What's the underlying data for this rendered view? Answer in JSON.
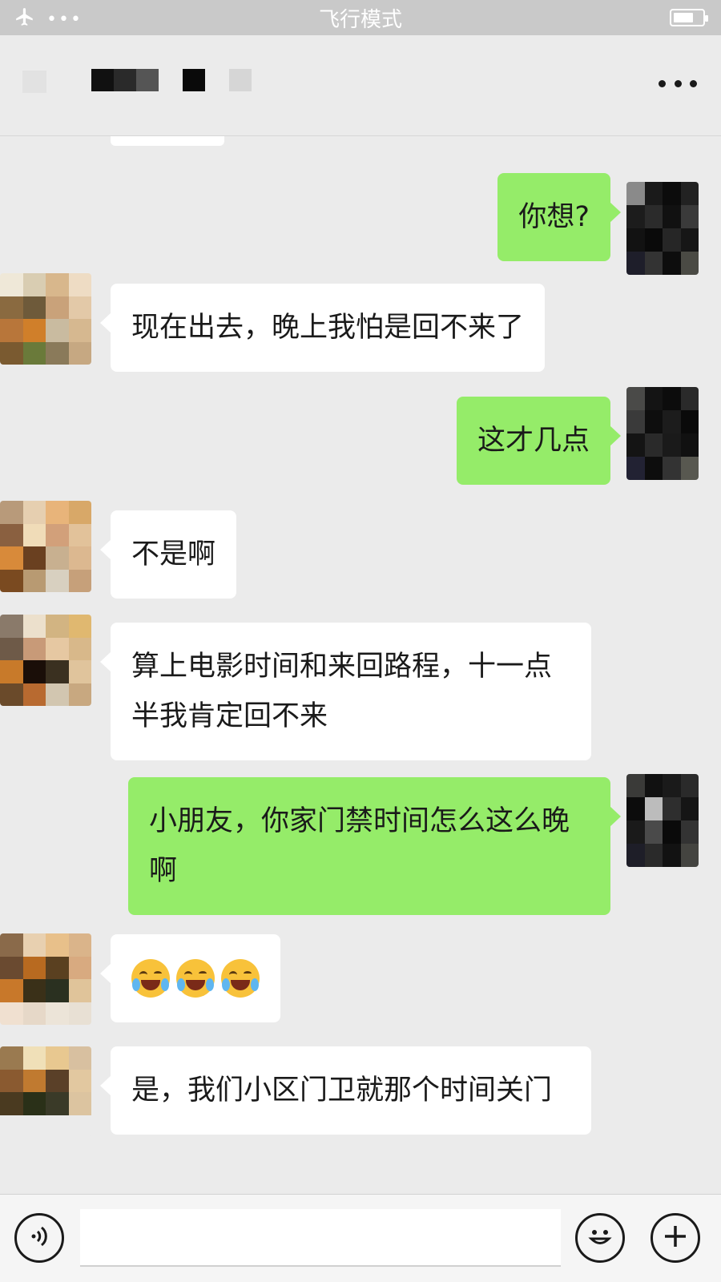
{
  "status_bar": {
    "mode_label": "飞行模式",
    "battery_level": 0.7
  },
  "nav": {
    "title": ""
  },
  "messages": [
    {
      "side": "out",
      "text": "你想?"
    },
    {
      "side": "in",
      "text": "现在出去，晚上我怕是回不来了"
    },
    {
      "side": "out",
      "text": "这才几点"
    },
    {
      "side": "in",
      "text": "不是啊"
    },
    {
      "side": "in",
      "text": "算上电影时间和来回路程，十一点半我肯定回不来"
    },
    {
      "side": "out",
      "text": "小朋友，你家门禁时间怎么这么晚啊"
    },
    {
      "side": "in",
      "emoji": [
        "face-with-tears-of-joy",
        "face-with-tears-of-joy",
        "face-with-tears-of-joy"
      ]
    },
    {
      "side": "in",
      "text": "是，我们小区门卫就那个时间关门"
    }
  ],
  "input_bar": {
    "placeholder": "",
    "voice_icon": "voice-icon",
    "emoji_icon": "smiley-icon",
    "plus_icon": "plus-icon"
  },
  "colors": {
    "outgoing_bubble": "#95ec69",
    "incoming_bubble": "#ffffff",
    "background": "#ebebeb"
  }
}
